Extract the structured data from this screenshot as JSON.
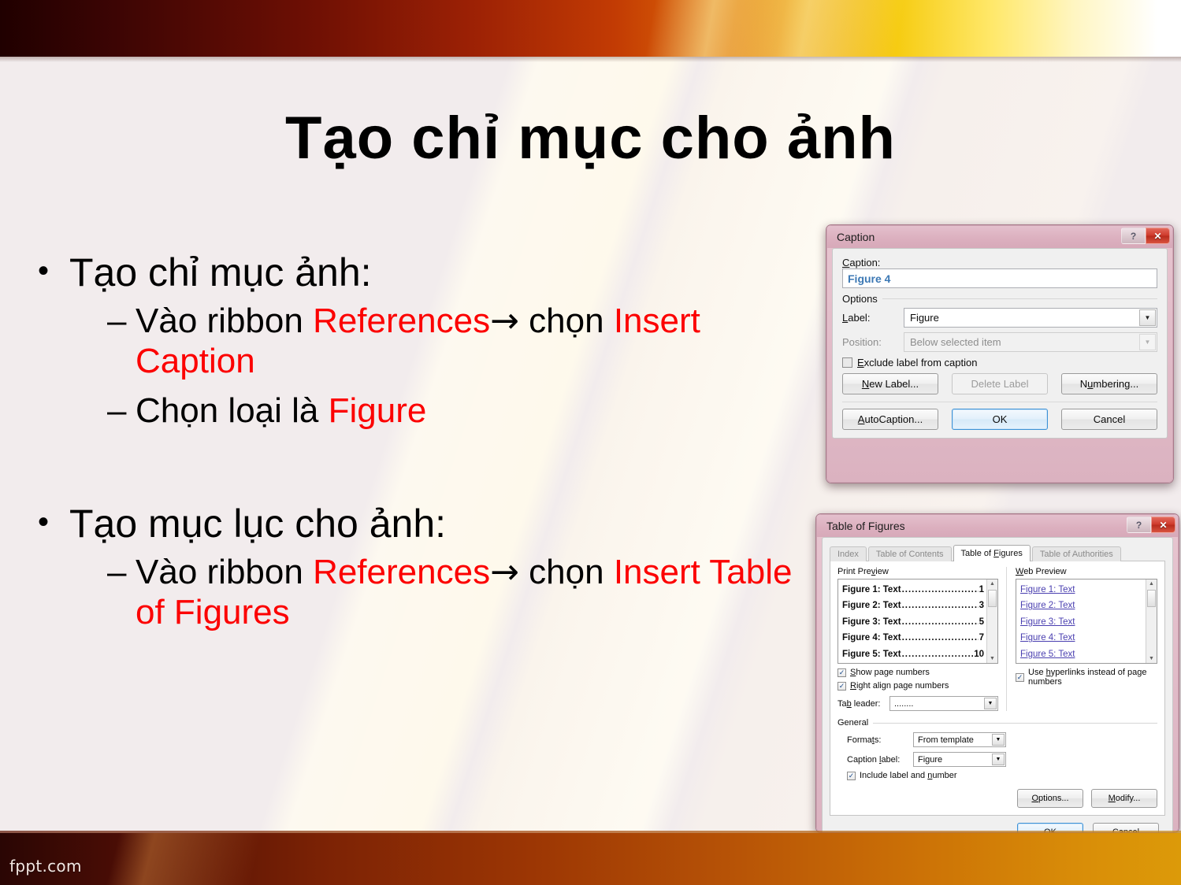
{
  "slide": {
    "title": "Tạo chỉ mục cho ảnh",
    "footer_brand": "fppt.com",
    "bullets": [
      {
        "level1": "Tạo chỉ mục ảnh:",
        "bullet_glyph": "•",
        "sub": [
          {
            "dash": "–",
            "pre": "Vào ribbon ",
            "red1": "References",
            "arrow": "→",
            "mid": " chọn ",
            "red2": "Insert Caption"
          },
          {
            "dash": "–",
            "pre": "Chọn loại là ",
            "red1": "Figure",
            "arrow": "",
            "mid": "",
            "red2": ""
          }
        ]
      },
      {
        "level1": "Tạo mục lục cho ảnh:",
        "bullet_glyph": "•",
        "sub": [
          {
            "dash": "–",
            "pre": "Vào ribbon ",
            "red1": "References",
            "arrow": "→",
            "mid": " chọn ",
            "red2": "Insert Table of Figures"
          }
        ]
      }
    ],
    "accent_red": "#fc0000"
  },
  "caption_dialog": {
    "title": "Caption",
    "help_glyph": "?",
    "close_glyph": "✕",
    "caption_label": "Caption:",
    "caption_value": "Figure 4",
    "options_group": "Options",
    "label_label": "Label:",
    "label_value": "Figure",
    "position_label": "Position:",
    "position_value": "Below selected item",
    "position_disabled": true,
    "exclude_checkbox": {
      "label": "Exclude label from caption",
      "checked": false
    },
    "buttons": {
      "new_label": "New Label...",
      "delete_label": "Delete Label",
      "delete_label_disabled": true,
      "numbering": "Numbering...",
      "autocaption": "AutoCaption...",
      "ok": "OK",
      "cancel": "Cancel"
    },
    "dropdown_glyph": "▼"
  },
  "tof_dialog": {
    "title": "Table of Figures",
    "help_glyph": "?",
    "close_glyph": "✕",
    "tabs": [
      {
        "label": "Index",
        "active": false
      },
      {
        "label": "Table of Contents",
        "active": false
      },
      {
        "label": "Table of Figures",
        "active": true
      },
      {
        "label": "Table of Authorities",
        "active": false
      }
    ],
    "print_preview": {
      "title": "Print Preview",
      "rows": [
        {
          "text": "Figure 1: Text",
          "page": "1"
        },
        {
          "text": "Figure 2: Text",
          "page": "3"
        },
        {
          "text": "Figure 3: Text",
          "page": "5"
        },
        {
          "text": "Figure 4: Text",
          "page": "7"
        },
        {
          "text": "Figure 5: Text",
          "page": "10"
        }
      ],
      "leader_dots": "............................"
    },
    "web_preview": {
      "title": "Web Preview",
      "links": [
        "Figure 1: Text",
        "Figure 2: Text",
        "Figure 3: Text",
        "Figure 4: Text",
        "Figure 5: Text"
      ]
    },
    "show_page_numbers": {
      "label": "Show page numbers",
      "checked": true
    },
    "right_align": {
      "label": "Right align page numbers",
      "checked": true
    },
    "use_hyperlinks": {
      "label": "Use hyperlinks instead of page numbers",
      "checked": true
    },
    "tab_leader": {
      "label": "Tab leader:",
      "value": "........"
    },
    "general": {
      "title": "General",
      "formats_label": "Formats:",
      "formats_value": "From template",
      "caption_label_label": "Caption label:",
      "caption_label_value": "Figure",
      "include_label": {
        "label": "Include label and number",
        "checked": true
      }
    },
    "buttons": {
      "options": "Options...",
      "modify": "Modify...",
      "ok": "OK",
      "cancel": "Cancel"
    },
    "check_glyph": "✓",
    "dropdown_glyph": "▼",
    "scroll_up": "▲",
    "scroll_down": "▼"
  }
}
